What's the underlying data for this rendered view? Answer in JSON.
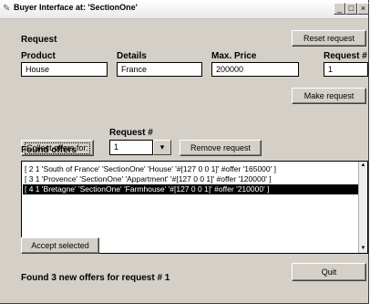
{
  "window": {
    "title": "Buyer Interface at: 'SectionOne'"
  },
  "request_section": {
    "heading": "Request",
    "reset_button": "Reset request",
    "product_label": "Product",
    "product_value": "House",
    "details_label": "Details",
    "details_value": "France",
    "max_price_label": "Max. Price",
    "max_price_value": "200000",
    "request_num_label": "Request #",
    "request_num_value": "1",
    "make_request_button": "Make request"
  },
  "collect_section": {
    "collect_button": "Collect offers for:",
    "request_num_label": "Request #",
    "request_num_value": "1",
    "dropdown_arrow": "▾",
    "remove_button": "Remove request"
  },
  "offers": {
    "heading": "Found offers",
    "items": [
      {
        "text": "[ 2  1  'South of France'  'SectionOne'  'House'  '#[127 0 0 1]'  #offer  '165000'  ]",
        "selected": false
      },
      {
        "text": "[ 3  1  'Provence'  'SectionOne'  'Appartment'  '#[127 0 0 1]'  #offer  '120000'  ]",
        "selected": false
      },
      {
        "text": "[ 4  1  'Bretagne'  'SectionOne'  'Farmhouse'  '#[127 0 0 1]'  #offer  '210000'  ]",
        "selected": true
      }
    ],
    "accept_button": "Accept selected"
  },
  "status": {
    "text": "Found 3 new offers for request # 1"
  },
  "quit_button": "Quit"
}
